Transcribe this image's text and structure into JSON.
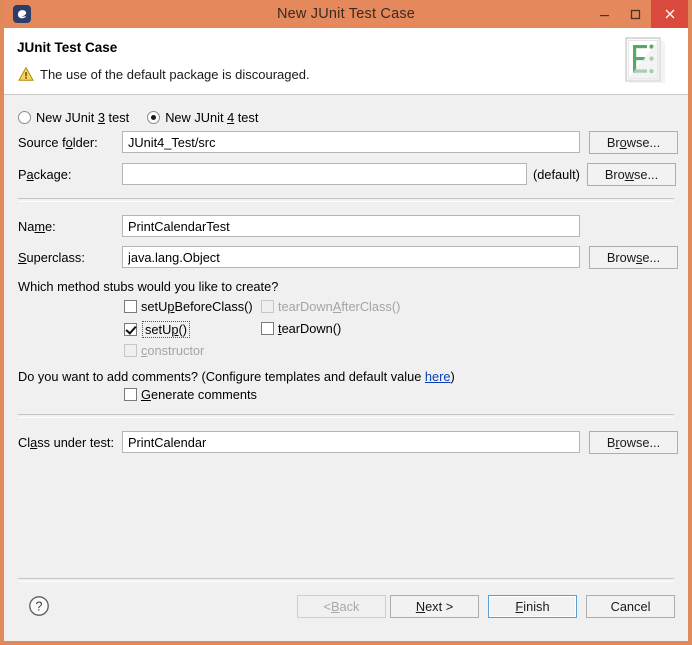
{
  "window": {
    "title": "New JUnit Test Case",
    "app_icon": "eclipse-icon",
    "controls": {
      "minimize": "minimize-icon",
      "maximize": "maximize-icon",
      "close": "close-icon"
    },
    "titlebar_color": "#e5895c",
    "close_color": "#d94a3d"
  },
  "header": {
    "title": "JUnit Test Case",
    "message": "The use of the default package is discouraged.",
    "message_icon": "warning-icon",
    "banner_icon": "junit-testcase-icon"
  },
  "test_kind": {
    "options": [
      {
        "label_pre": "New JUnit ",
        "mnemonic": "3",
        "label_post": " test",
        "selected": false
      },
      {
        "label_pre": "New JUnit ",
        "mnemonic": "4",
        "label_post": " test",
        "selected": true
      }
    ]
  },
  "fields": {
    "source_folder": {
      "label_pre": "Source f",
      "label_mn": "o",
      "label_post": "lder:",
      "value": "JUnit4_Test/src",
      "browse": {
        "pre": "Br",
        "mn": "o",
        "post": "wse..."
      }
    },
    "package": {
      "label_pre": "P",
      "label_mn": "a",
      "label_post": "ckage:",
      "value": "",
      "placeholder": "",
      "suffix": "(default)",
      "browse": {
        "pre": "Bro",
        "mn": "w",
        "post": "se..."
      }
    },
    "name": {
      "label_pre": "Na",
      "label_mn": "m",
      "label_post": "e:",
      "value": "PrintCalendarTest"
    },
    "superclass": {
      "label_pre": "",
      "label_mn": "S",
      "label_post": "uperclass:",
      "value": "java.lang.Object",
      "browse": {
        "pre": "Brow",
        "mn": "s",
        "post": "e..."
      }
    },
    "class_under_test": {
      "label_pre": "Cl",
      "label_mn": "a",
      "label_post": "ss under test:",
      "value": "PrintCalendar",
      "browse": {
        "pre": "B",
        "mn": "r",
        "post": "owse..."
      }
    }
  },
  "stubs": {
    "question": "Which method stubs would you like to create?",
    "items": [
      {
        "pre": "setU",
        "mn": "p",
        "post": "BeforeClass()",
        "checked": false,
        "enabled": true,
        "focused": false,
        "col": 1,
        "line": 1
      },
      {
        "pre": "tearDown",
        "mn": "A",
        "post": "fterClass()",
        "checked": false,
        "enabled": false,
        "focused": false,
        "col": 2,
        "line": 1
      },
      {
        "pre": "setU",
        "mn": "p",
        "post": "()",
        "checked": true,
        "enabled": true,
        "focused": true,
        "col": 1,
        "line": 2
      },
      {
        "pre": "",
        "mn": "t",
        "post": "earDown()",
        "checked": false,
        "enabled": true,
        "focused": false,
        "col": 2,
        "line": 2
      },
      {
        "pre": "",
        "mn": "c",
        "post": "onstructor",
        "checked": false,
        "enabled": false,
        "focused": false,
        "col": 1,
        "line": 3
      }
    ]
  },
  "comments": {
    "question_pre": "Do you want to add comments? (Configure templates and default value ",
    "link": "here",
    "question_post": ")",
    "checkbox": {
      "pre": "",
      "mn": "G",
      "post": "enerate comments",
      "checked": false
    },
    "link_color": "#0b3fb5"
  },
  "buttons": {
    "help": "help-icon",
    "back": {
      "pre": "< ",
      "mn": "B",
      "post": "ack",
      "enabled": false,
      "default": false
    },
    "next": {
      "pre": "",
      "mn": "N",
      "post": "ext >",
      "enabled": true,
      "default": false
    },
    "finish": {
      "pre": "",
      "mn": "F",
      "post": "inish",
      "enabled": true,
      "default": true
    },
    "cancel": {
      "pre": "",
      "mn": "",
      "post": "Cancel",
      "enabled": true,
      "default": false
    }
  }
}
